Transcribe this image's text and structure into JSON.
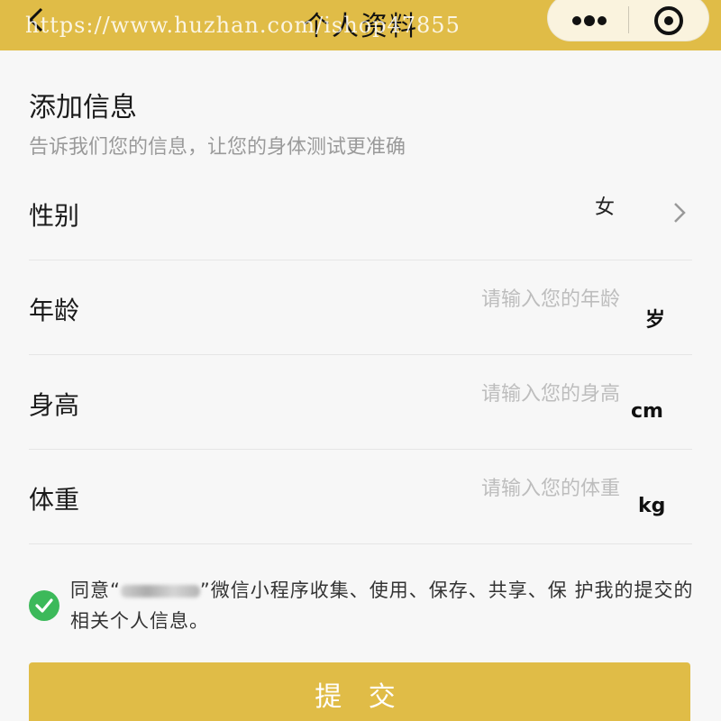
{
  "header": {
    "title": "个人资料",
    "watermark": "https://www.huzhan.com/ishop47855",
    "back_icon": "chevron-left-icon",
    "more_icon": "more-dots-icon",
    "close_icon": "target-close-icon"
  },
  "intro": {
    "title": "添加信息",
    "subtitle": "告诉我们您的信息，让您的身体测试更准确"
  },
  "form": {
    "gender": {
      "label": "性别",
      "value": "女"
    },
    "age": {
      "label": "年龄",
      "placeholder": "请输入您的年龄",
      "unit": "岁"
    },
    "height": {
      "label": "身高",
      "placeholder": "请输入您的身高",
      "unit": "cm"
    },
    "weight": {
      "label": "体重",
      "placeholder": "请输入您的体重",
      "unit": "kg"
    }
  },
  "agreement": {
    "checked": true,
    "prefix": "同意“",
    "suffix": "”微信小程序收集、使用、保存、共享、保 护我的提交的相关个人信息。"
  },
  "submit_label": "提 交",
  "colors": {
    "accent": "#e0bc47",
    "check": "#3cb95a",
    "placeholder": "#bdbdbd"
  }
}
